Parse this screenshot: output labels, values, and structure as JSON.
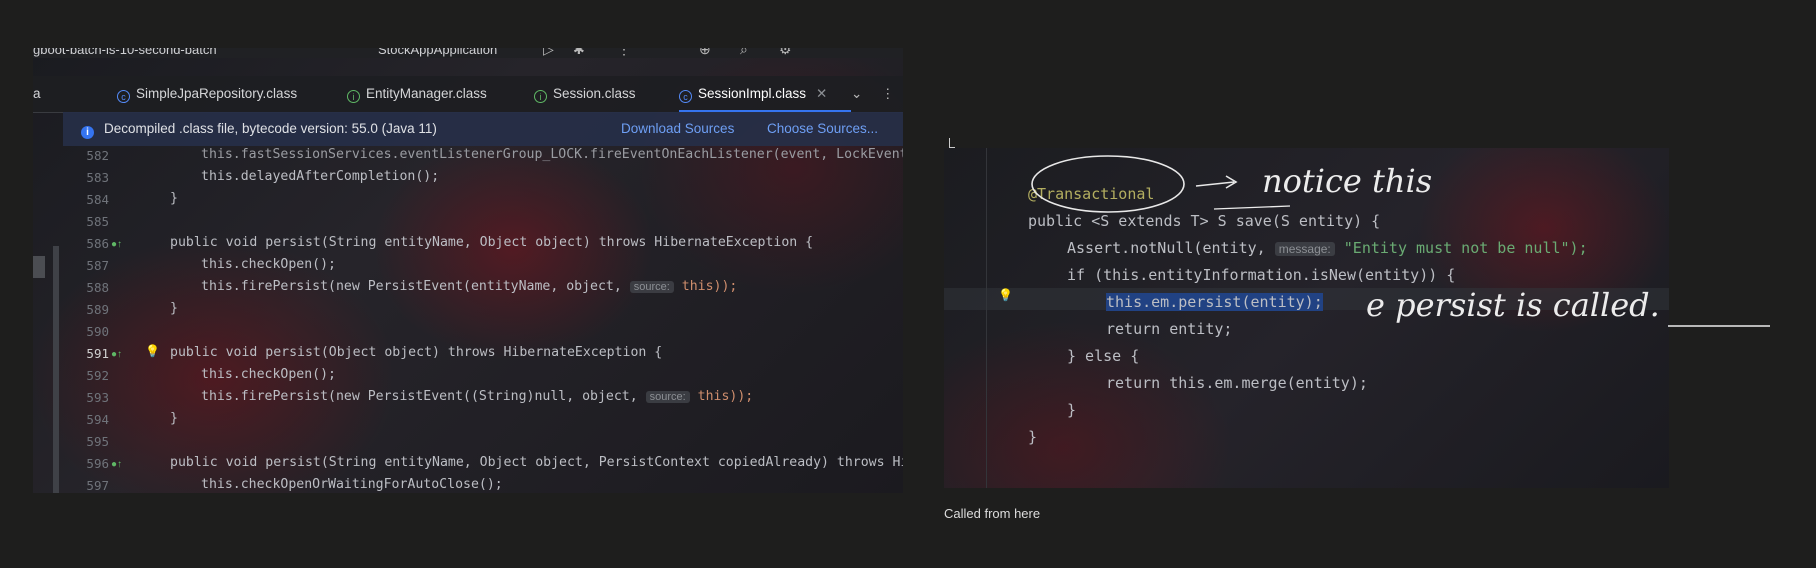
{
  "toolbar": {
    "project_name": "gboot-batch-is-10-second-batch",
    "run_config": "StockAppApplication"
  },
  "tabs": [
    {
      "label": "a",
      "icon": "",
      "active": false
    },
    {
      "label": "SimpleJpaRepository.class",
      "icon": "class-icon",
      "active": false
    },
    {
      "label": "EntityManager.class",
      "icon": "interface-icon",
      "active": false
    },
    {
      "label": "Session.class",
      "icon": "interface-icon",
      "active": false
    },
    {
      "label": "SessionImpl.class",
      "icon": "class-icon",
      "active": true
    }
  ],
  "banner": {
    "text": "Decompiled .class file, bytecode version: 55.0 (Java 11)",
    "download_sources": "Download Sources",
    "choose_sources": "Choose Sources..."
  },
  "left_code": {
    "line_numbers": [
      "582",
      "583",
      "584",
      "585",
      "586",
      "587",
      "588",
      "589",
      "590",
      "591",
      "592",
      "593",
      "594",
      "595",
      "596",
      "597"
    ],
    "lines": [
      "this.fastSessionServices.eventListenerGroup_LOCK.fireEventOnEachListener(event, LockEventLi",
      "this.delayedAfterCompletion();",
      "}",
      "",
      "public void persist(String entityName, Object object) throws HibernateException {",
      "this.checkOpen();",
      "this.firePersist(new PersistEvent(entityName, object,",
      "}",
      "",
      "public void persist(Object object) throws HibernateException {",
      "this.checkOpen();",
      "this.firePersist(new PersistEvent((String)null, object,",
      "}",
      "",
      "public void persist(String entityName, Object object, PersistContext copiedAlready) throws Hibe",
      "this.checkOpenOrWaitingForAutoClose();"
    ],
    "inlay_source": "source:",
    "this_kw": "this));"
  },
  "right_code": {
    "annotation": "@Transactional",
    "signature": "public <S extends T> S save(S entity) {",
    "assert_line": "Assert.notNull(entity,",
    "assert_hint": "message:",
    "assert_msg": "\"Entity must not be null\");",
    "if_line": "if (this.entityInformation.isNew(entity)) {",
    "persist_line": "this.em.persist(entity);",
    "return_entity": "return entity;",
    "else_line": "} else {",
    "merge_line": "return this.em.merge(entity);",
    "close_inner": "}",
    "close_outer": "}"
  },
  "handwriting": {
    "note1": "notice this",
    "note2": "e persist is called."
  },
  "caption": "Called from here"
}
